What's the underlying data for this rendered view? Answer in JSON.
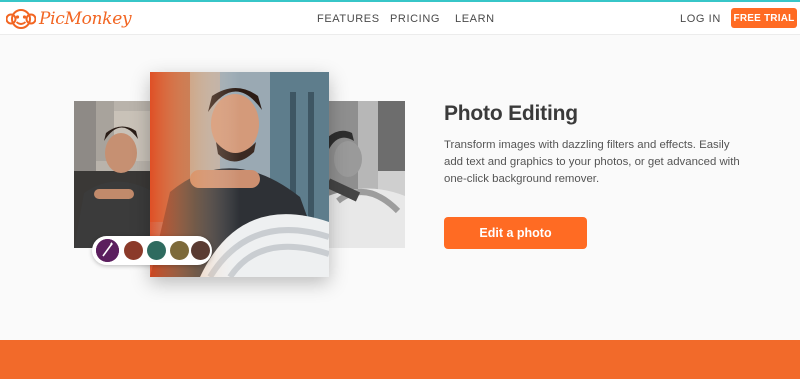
{
  "brand": {
    "name": "PicMonkey",
    "accent": "#ff6b23",
    "topline": "#37c6c8"
  },
  "nav": {
    "features": "FEATURES",
    "pricing": "PRICING",
    "learn": "LEARN",
    "login": "LOG IN",
    "trial": "FREE TRIAL"
  },
  "hero": {
    "title": "Photo Editing",
    "description": "Transform images with dazzling filters and effects. Easily add text and graphics to your photos, or get advanced with one-click background remover.",
    "cta": "Edit a photo"
  },
  "filter_swatches": [
    "filter-1",
    "filter-2",
    "filter-3",
    "filter-4",
    "filter-5"
  ]
}
